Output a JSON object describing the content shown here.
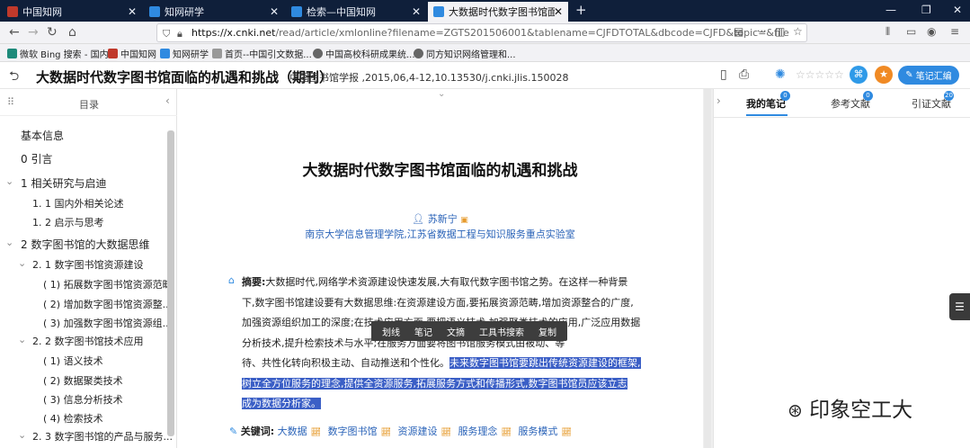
{
  "browser": {
    "tabs": [
      {
        "title": "中国知网",
        "color": "#c0392b"
      },
      {
        "title": "知网研学",
        "color": "#2f8ae0"
      },
      {
        "title": "检索—中国知网",
        "color": "#2f8ae0"
      },
      {
        "title": "大数据时代数字图书馆面临的",
        "color": "#2f8ae0"
      }
    ],
    "url_host": "https://x.cnki.net",
    "url_path": "/read/article/xmlonline?filename=ZGTS201506001&tablename=CJFDTOTAL&dbcode=CJFD&topic=&file",
    "url_dots": "···",
    "bookmarks": [
      "微软 Bing 搜索 - 国内...",
      "中国知网",
      "知网研学",
      "首页--中国引文数据...",
      "中国高校科研成果统...",
      "同方知识网络管理和..."
    ]
  },
  "header": {
    "title": "大数据时代数字图书馆面临的机遇和挑战（期刊）",
    "source": "中国图书馆学报 ,2015,06,4-12,10.13530/j.cnki.jlis.150028",
    "rating": "☆☆☆☆☆",
    "notes_button": "笔记汇编"
  },
  "sidebar": {
    "heading": "目录",
    "items": [
      "基本信息",
      "0 引言",
      "1 相关研究与启迪",
      "1. 1 国内外相关论述",
      "1. 2 启示与思考",
      "2 数字图书馆的大数据思维",
      "2. 1 数字图书馆资源建设",
      "( 1) 拓展数字图书馆资源范畴",
      "( 2) 增加数字图书馆资源整...",
      "( 3) 加强数字图书馆资源组...",
      "2. 2 数字图书馆技术应用",
      "( 1) 语义技术",
      "( 2) 数据聚类技术",
      "( 3) 信息分析技术",
      "( 4) 检索技术",
      "2. 3 数字图书馆的产品与服务..."
    ]
  },
  "article": {
    "title": "大数据时代数字图书馆面临的机遇和挑战",
    "author": "苏新宁",
    "affiliation": "南京大学信息管理学院,江苏省数据工程与知识服务重点实验室",
    "abstract_label": "摘要:",
    "abstract_lines": [
      "大数据时代,网络学术资源建设快速发展,大有取代数字图书馆之势。在这样一种背景",
      "下,数字图书馆建设要有大数据思维:在资源建设方面,要拓展资源范畴,增加资源整合的广度,",
      "加强资源组织加工的深度;在技术应用方面,要把语义技术,加强聚类技术的应用,广泛应用数据",
      "分析技术,提升检索技术与水平;在服务方面要将图书馆服务模式由被动、等",
      "待、共性化转向积极主动、自动推送和个性化。"
    ],
    "abstract_highlight": [
      "未来数字图书馆要跳出传统资源建设的框架,",
      "树立全方位服务的理念,提供全资源服务,拓展服务方式和传播形式,数字图书馆员应该立志",
      "成为数据分析家。"
    ],
    "popup_menu": [
      "划线",
      "笔记",
      "文摘",
      "工具书搜索",
      "复制"
    ],
    "keywords_label": "关键词:",
    "keywords": [
      "大数据",
      "数字图书馆",
      "资源建设",
      "服务理念",
      "服务模式"
    ]
  },
  "right_panel": {
    "tabs": [
      {
        "label": "我的笔记",
        "count": "0"
      },
      {
        "label": "参考文献",
        "count": "0"
      },
      {
        "label": "引证文献",
        "count": "20"
      }
    ]
  },
  "watermark": "印象空工大",
  "colors": {
    "accent": "#2f8ae0",
    "highlight": "#3b5fc6",
    "tabbar": "#0f1f3a"
  }
}
